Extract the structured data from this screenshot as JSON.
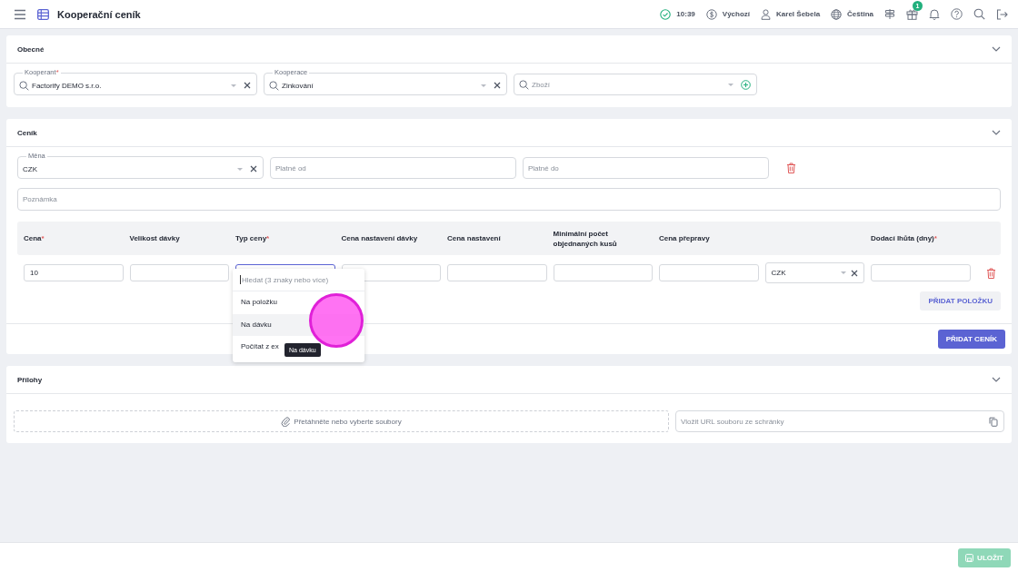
{
  "topbar": {
    "title": "Kooperační ceník",
    "status_time": "10:39",
    "currency": "Výchozí",
    "user": "Karel Šebela",
    "language": "Čeština",
    "gift_badge": "1"
  },
  "general": {
    "title": "Obecné",
    "fields": [
      {
        "kind": "clearable",
        "label": "Kooperant",
        "required_mark": "*",
        "value": "Factorify DEMO s.r.o."
      },
      {
        "kind": "clearable",
        "label": "Kooperace",
        "value": "Zinkování"
      },
      {
        "kind": "addable",
        "placeholder": "Zboží"
      }
    ]
  },
  "pricelist": {
    "title": "Ceník",
    "currency": {
      "label": "Měna",
      "value": "CZK"
    },
    "valid_from": {
      "placeholder": "Platné od"
    },
    "valid_to": {
      "placeholder": "Platné do"
    },
    "note": {
      "placeholder": "Poznámka"
    },
    "table": {
      "columns": [
        {
          "label": "Cena",
          "required_mark": "*"
        },
        {
          "label": "Velikost dávky"
        },
        {
          "label": "Typ ceny",
          "required_mark": "*"
        },
        {
          "label": "Cena nastavení dávky"
        },
        {
          "label": "Cena nastavení"
        },
        {
          "label": "Minimální počet objednaných kusů"
        },
        {
          "label": "Cena přepravy"
        },
        {},
        {
          "label": "Dodací lhůta (dny)",
          "required_mark": "*"
        }
      ],
      "rows": [
        {
          "cells": [
            {
              "kind": "input",
              "value": "10"
            },
            {
              "kind": "input"
            },
            {
              "kind": "dropdown"
            },
            {
              "kind": "input"
            },
            {
              "kind": "input"
            },
            {
              "kind": "input"
            },
            {
              "kind": "input"
            },
            {
              "kind": "select",
              "value": "CZK"
            },
            {
              "kind": "input"
            }
          ]
        }
      ]
    },
    "dropdown": {
      "search_placeholder": "Hledat (3 znaky nebo více)",
      "options": [
        {
          "label": "Na položku",
          "hovered": false
        },
        {
          "label": "Na dávku",
          "hovered": true
        },
        {
          "label": "Počítat z ex",
          "hovered": false
        }
      ],
      "tooltip": "Na dávku"
    },
    "add_item_button": "PŘIDAT POLOŽKU",
    "add_pricelist_button": "PŘIDAT CENÍK"
  },
  "attachments": {
    "title": "Přílohy",
    "dropzone": "Přetáhněte nebo vyberte soubory",
    "url_placeholder": "Vložit URL souboru ze schránky"
  },
  "save_button": "ULOŽIT"
}
